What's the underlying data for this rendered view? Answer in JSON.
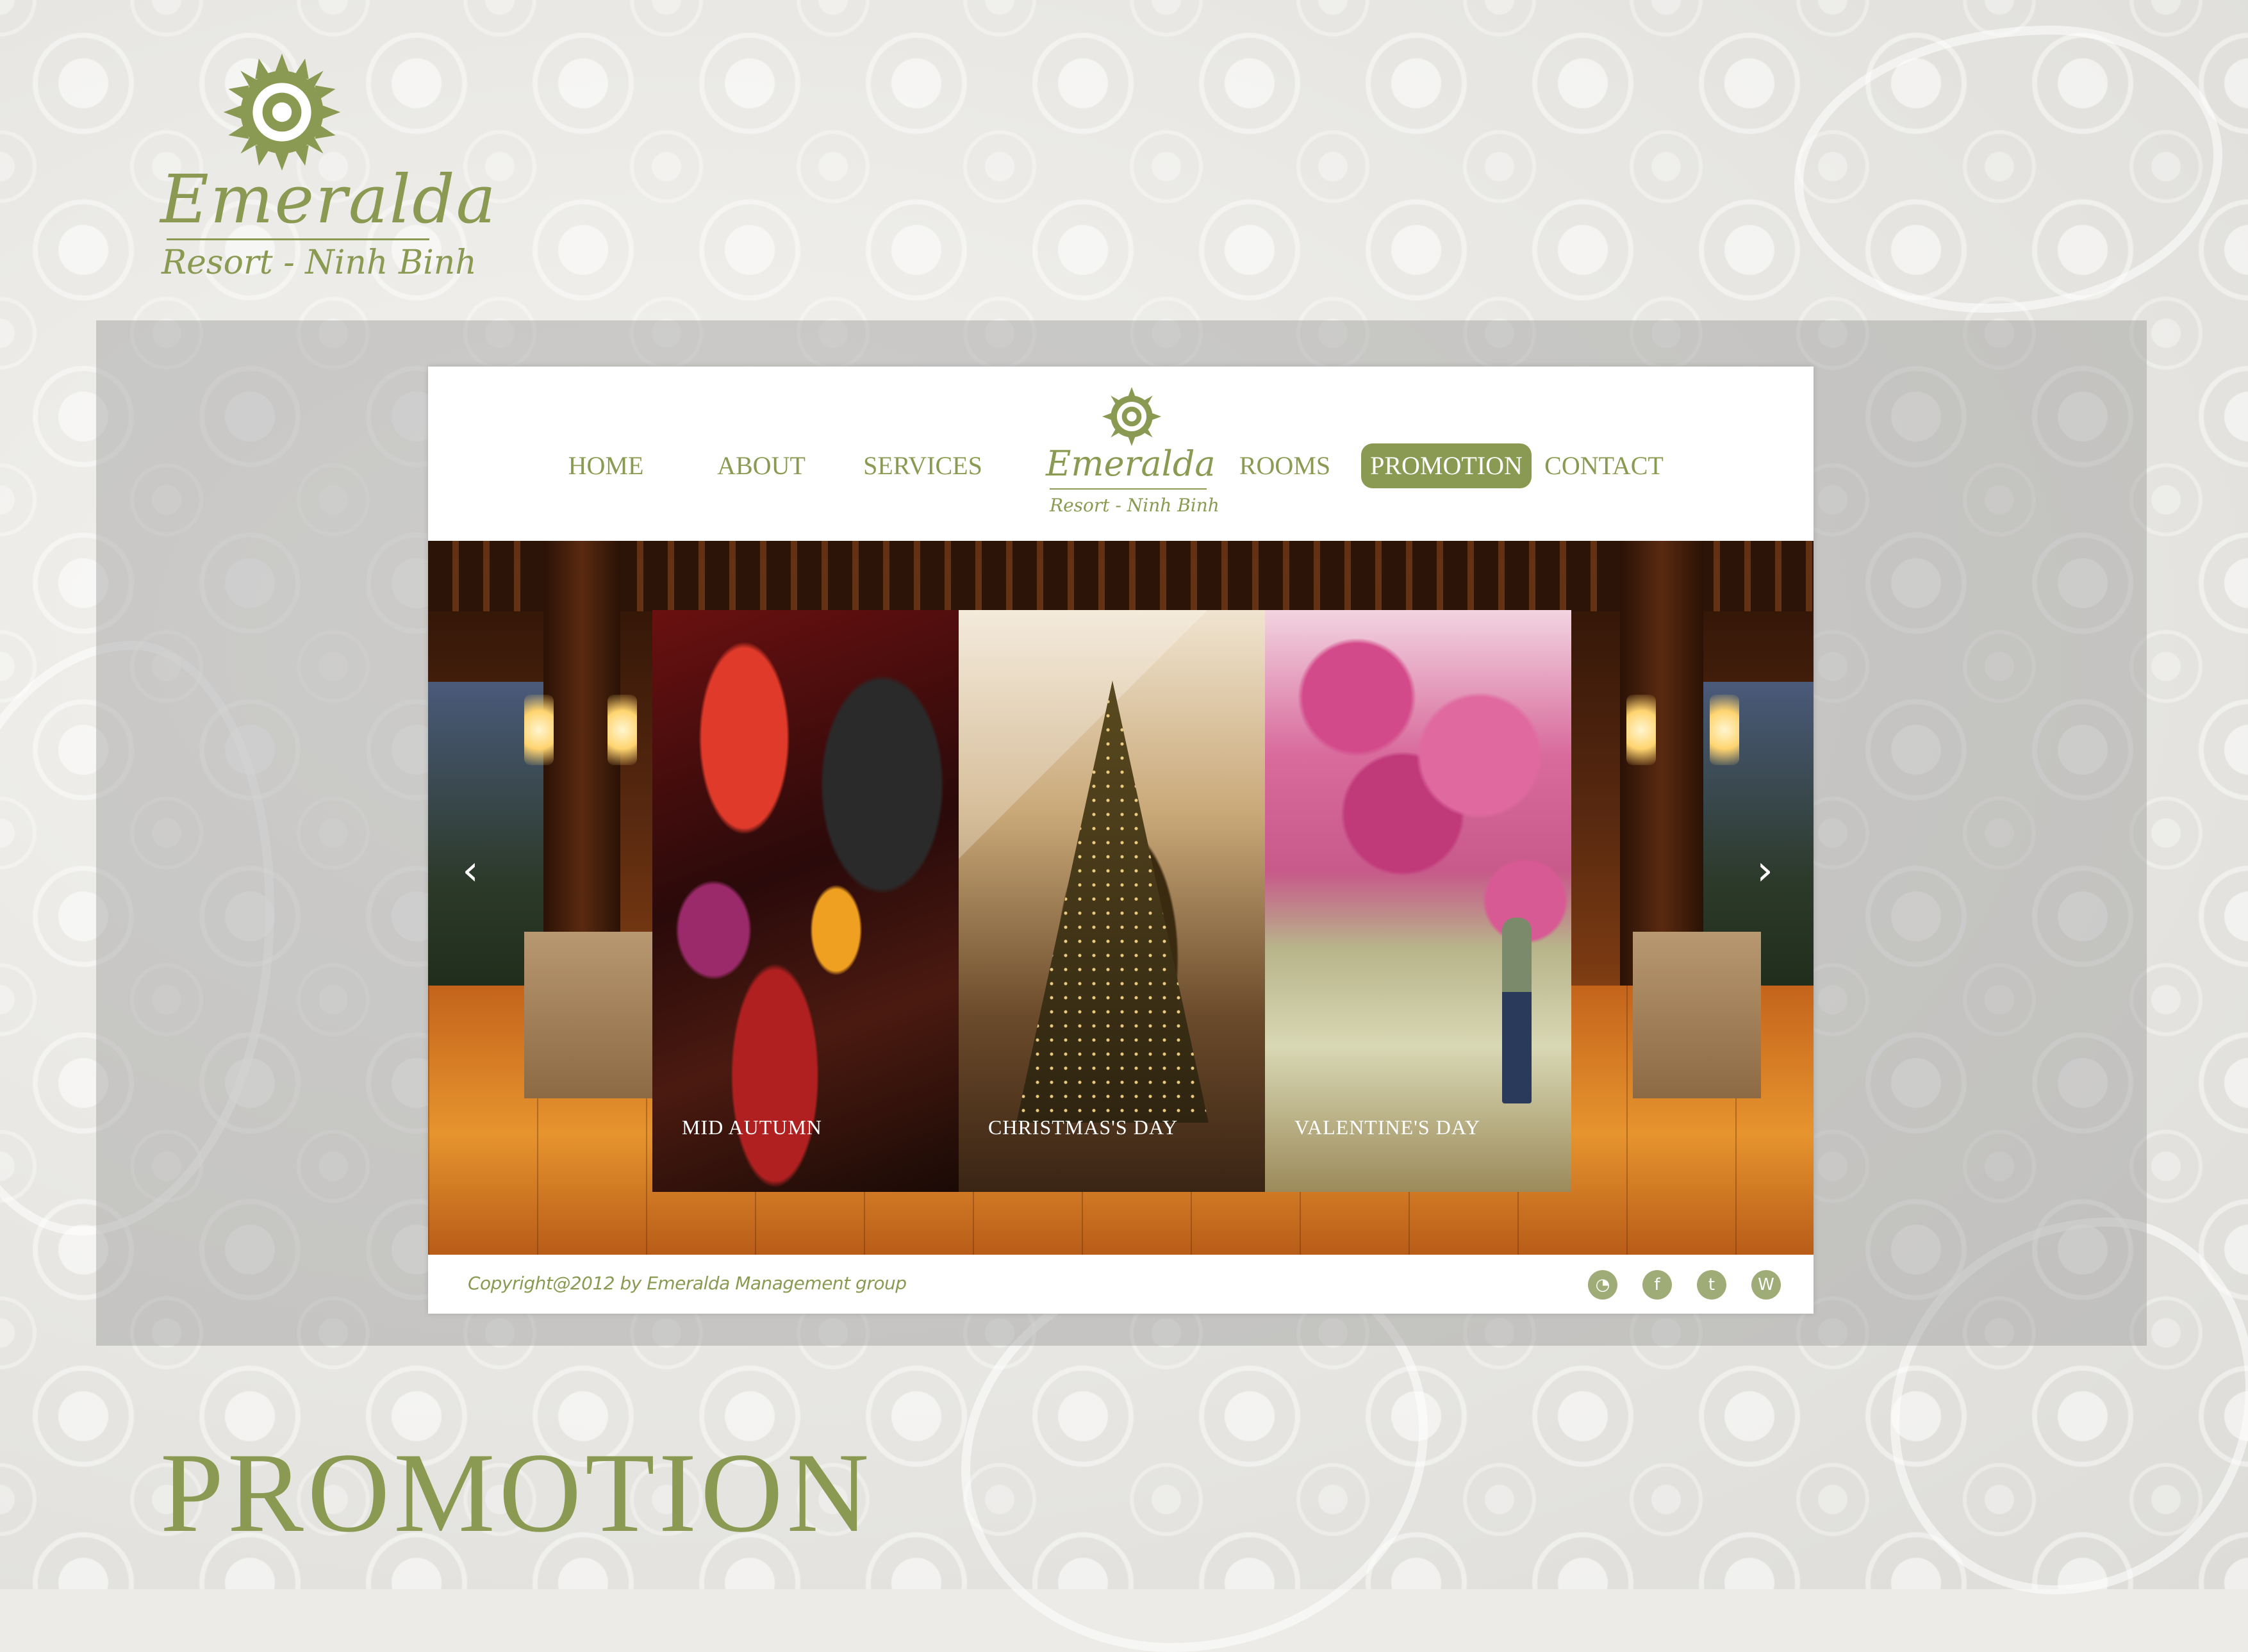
{
  "brand": {
    "name": "Emeralda",
    "tagline": "Resort - Ninh Binh"
  },
  "colors": {
    "accent": "#8a9a52",
    "white": "#ffffff",
    "band": "#969696"
  },
  "nav": {
    "items": [
      {
        "label": "HOME",
        "active": false
      },
      {
        "label": "ABOUT",
        "active": false
      },
      {
        "label": "SERVICES",
        "active": false
      },
      {
        "label": "ROOMS",
        "active": false
      },
      {
        "label": "PROMOTION",
        "active": true
      },
      {
        "label": "CONTACT",
        "active": false
      }
    ]
  },
  "hero": {
    "prev_icon": "chevron-left-icon",
    "next_icon": "chevron-right-icon",
    "prev_glyph": "‹",
    "next_glyph": "›",
    "cards": [
      {
        "caption": "MID AUTUMN"
      },
      {
        "caption": "CHRISTMAS'S DAY"
      },
      {
        "caption": "VALENTINE'S DAY"
      }
    ]
  },
  "footer": {
    "copyright": "Copyright@2012 by Emeralda Management group",
    "social": [
      {
        "name": "rss-icon",
        "glyph": "◔"
      },
      {
        "name": "facebook-icon",
        "glyph": "f"
      },
      {
        "name": "twitter-icon",
        "glyph": "t"
      },
      {
        "name": "wordpress-icon",
        "glyph": "W"
      }
    ]
  },
  "page_title": "PROMOTION"
}
